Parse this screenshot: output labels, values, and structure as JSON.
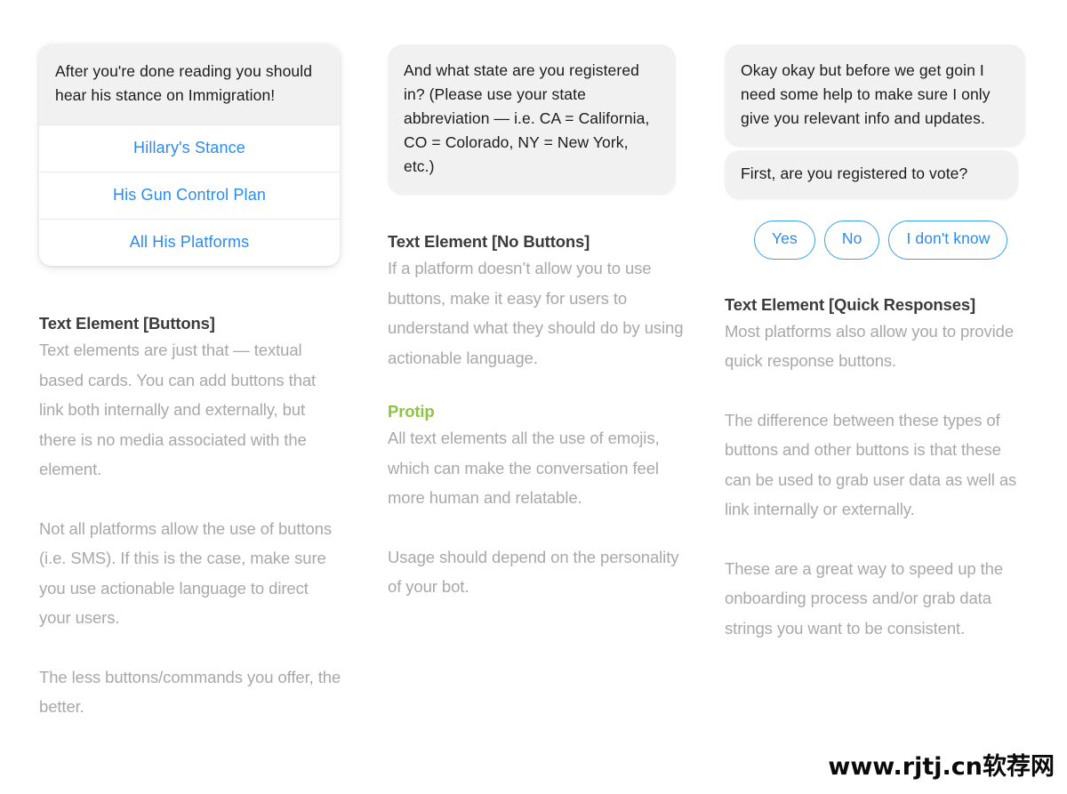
{
  "columns": [
    {
      "id": "buttons",
      "card": {
        "message": "After you're done reading you should hear his stance on Immigration!",
        "buttons": [
          "Hillary's Stance",
          "His Gun Control Plan",
          "All His Platforms"
        ]
      },
      "heading": "Text Element [Buttons]",
      "paragraphs": [
        "Text elements are just that — textual based cards. You can add buttons that link both internally and externally, but there is no media associated with the element.",
        "Not all platforms allow the use of buttons (i.e. SMS). If this is the case, make sure you use actionable language to direct your users.",
        "The less buttons/commands you offer, the better."
      ]
    },
    {
      "id": "no-buttons",
      "bubble": "And what state are you registered in? (Please use your state abbreviation — i.e. CA = California, CO = Colorado, NY = New York, etc.)",
      "heading": "Text Element [No Buttons]",
      "paragraphs": [
        "If a platform doesn’t  allow you to use buttons, make it easy for users to understand what they should do by using actionable language."
      ],
      "protip_heading": "Protip",
      "protip_paragraphs": [
        "All text elements all the use of emojis, which can make the conversation feel more human and relatable.",
        "Usage should depend on the personality of your bot."
      ],
      "protip_color": "#8CC63F"
    },
    {
      "id": "quick-responses",
      "bubbles": [
        "Okay okay but before we get goin I need some help to make sure I only give you relevant info and updates.",
        "First, are you registered to vote?"
      ],
      "quick_replies": [
        "Yes",
        "No",
        "I don't know"
      ],
      "heading": "Text Element [Quick Responses]",
      "paragraphs": [
        "Most platforms also allow you to provide quick response buttons.",
        "The difference between these types of buttons and other buttons is that these can be used to grab user data as well as link internally or externally.",
        "These are a great way to speed up the onboarding process and/or grab data strings you want to be consistent."
      ]
    }
  ],
  "watermark": "www.rjtj.cn软荐网",
  "colors": {
    "link_blue": "#2a8cf0",
    "pill_border": "#3aa0e8",
    "bubble_gray": "#f1f1f1",
    "body_text_gray": "#a8a8a8",
    "heading_dark": "#3b3b3b",
    "protip_green": "#8CC63F"
  }
}
